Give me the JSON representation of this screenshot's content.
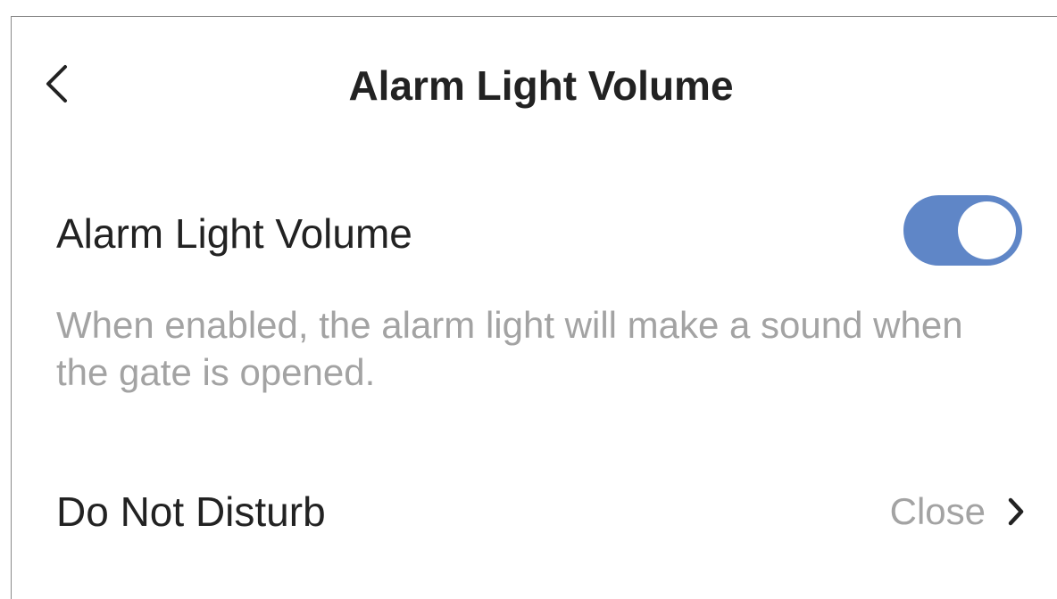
{
  "header": {
    "back_icon": "chevron-left-icon",
    "title": "Alarm Light Volume"
  },
  "alarm_setting": {
    "label": "Alarm Light Volume",
    "enabled": true,
    "toggle_color": "#5f86c7",
    "description": "When enabled, the alarm light will make a sound when the gate is opened."
  },
  "do_not_disturb": {
    "label": "Do Not Disturb",
    "value": "Close",
    "icon": "chevron-right-icon"
  }
}
